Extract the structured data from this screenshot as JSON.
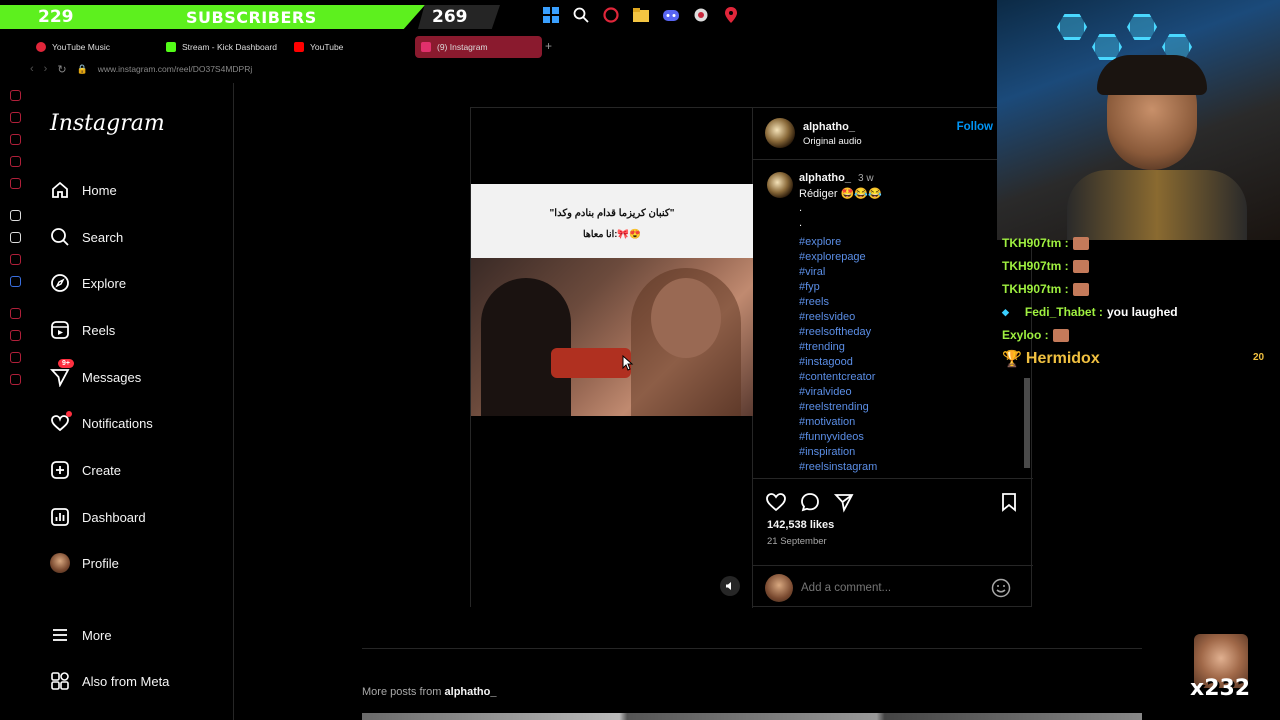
{
  "subbar": {
    "left_count": "229",
    "label": "SUBSCRIBERS",
    "right_count": "269"
  },
  "tabs": [
    {
      "label": "YouTube Music",
      "color": "#e0263a"
    },
    {
      "label": "Stream - Kick Dashboard",
      "color": "#53fc18"
    },
    {
      "label": "YouTube",
      "color": "#ff0000"
    },
    {
      "label": "(9) Instagram",
      "color": "#e1306c"
    }
  ],
  "address": {
    "url": "www.instagram.com/reel/DO37S4MDPRj"
  },
  "instagram": {
    "logo": "Instagram",
    "nav": {
      "home": "Home",
      "search": "Search",
      "explore": "Explore",
      "reels": "Reels",
      "messages": "Messages",
      "messages_badge": "9+",
      "notifications": "Notifications",
      "create": "Create",
      "dashboard": "Dashboard",
      "profile": "Profile",
      "more": "More",
      "meta": "Also from Meta"
    }
  },
  "post": {
    "video_line1": "\"كنبان كريزما قدام بنادم وكدا\"",
    "video_line2": "انا معاها:🎀😍",
    "username": "alphatho_",
    "audio": "Original audio",
    "follow": "Follow",
    "caption_user": "alphatho_",
    "caption_age": "3 w",
    "caption_text": "Rédiger 🤩😂😂",
    "dot1": ".",
    "dot2": ".",
    "hashtags": [
      "#explore",
      "#explorepage",
      "#viral",
      "#fyp",
      "#reels",
      "#reelsvideo",
      "#reelsoftheday",
      "#trending",
      "#instagood",
      "#contentcreator",
      "#viralvideo",
      "#reelstrending",
      "#motivation",
      "#funnyvideos",
      "#inspiration",
      "#reelsinstagram"
    ],
    "likes": "142,538 likes",
    "date": "21 September",
    "comment_placeholder": "Add a comment..."
  },
  "more_posts": {
    "prefix": "More posts from",
    "user": "alphatho_"
  },
  "chat": [
    {
      "name": "TKH907tm :",
      "msg": ""
    },
    {
      "name": "TKH907tm :",
      "msg": ""
    },
    {
      "name": "TKH907tm :",
      "msg": ""
    },
    {
      "name": "Fedi_Thabet :",
      "msg": "you laughed"
    },
    {
      "name": "Exyloo :",
      "msg": ""
    },
    {
      "name": "Hermidox",
      "msg": ""
    }
  ],
  "overlay": {
    "count": "20",
    "combo": "x232"
  }
}
